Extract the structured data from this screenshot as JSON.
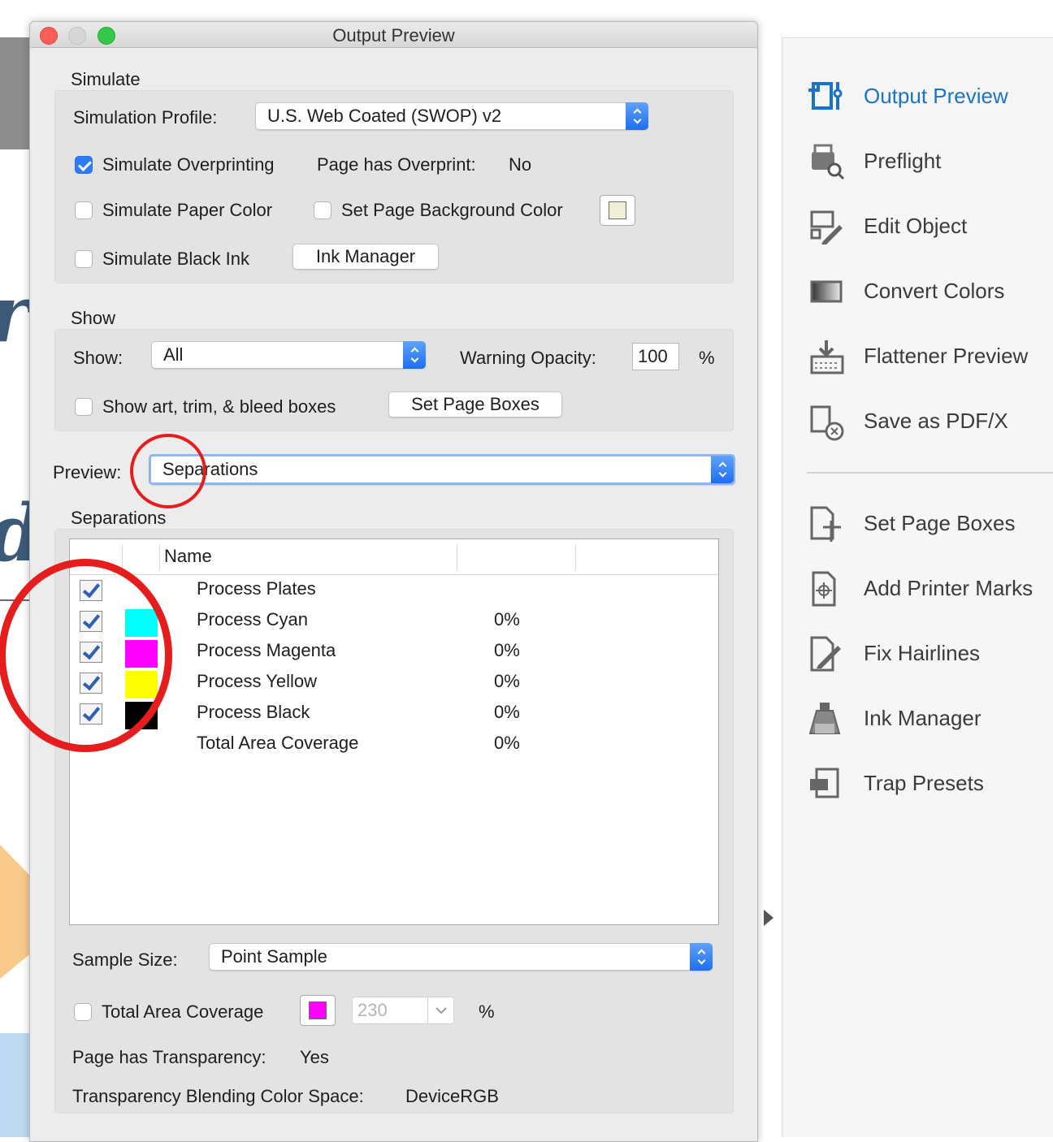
{
  "dialog": {
    "title": "Output Preview"
  },
  "simulate": {
    "section": "Simulate",
    "profile_label": "Simulation Profile:",
    "profile_value": "U.S. Web Coated (SWOP) v2",
    "overprint_label": "Simulate Overprinting",
    "overprint_checked": true,
    "page_overprint_label": "Page has Overprint:",
    "page_overprint_value": "No",
    "paper_color_label": "Simulate Paper Color",
    "bg_color_label": "Set Page Background Color",
    "black_ink_label": "Simulate Black Ink",
    "ink_manager_button": "Ink Manager",
    "bg_swatch_color": "#efefd8"
  },
  "show": {
    "section": "Show",
    "show_label": "Show:",
    "show_value": "All",
    "warning_label": "Warning Opacity:",
    "warning_value": "100",
    "percent": "%",
    "boxes_label": "Show art, trim, & bleed boxes",
    "set_page_boxes_button": "Set Page Boxes"
  },
  "preview": {
    "label": "Preview:",
    "value": "Separations"
  },
  "separations": {
    "section": "Separations",
    "name_header": "Name",
    "rows": [
      {
        "name": "Process Plates",
        "pct": "",
        "color": ""
      },
      {
        "name": "Process Cyan",
        "pct": "0%",
        "color": "#00ffff"
      },
      {
        "name": "Process Magenta",
        "pct": "0%",
        "color": "#ff00ff"
      },
      {
        "name": "Process Yellow",
        "pct": "0%",
        "color": "#ffff00"
      },
      {
        "name": "Process Black",
        "pct": "0%",
        "color": "#000000"
      },
      {
        "name": "Total Area Coverage",
        "pct": "0%",
        "color": ""
      }
    ]
  },
  "sample": {
    "label": "Sample Size:",
    "value": "Point Sample",
    "tac_label": "Total Area Coverage",
    "tac_value": "230",
    "tac_swatch": "#ff00ff",
    "percent": "%",
    "transparency_label": "Page has Transparency:",
    "transparency_value": "Yes",
    "blend_label": "Transparency Blending Color Space:",
    "blend_value": "DeviceRGB"
  },
  "tools": [
    {
      "label": "Output Preview",
      "icon": "output-preview-icon",
      "active": true
    },
    {
      "label": "Preflight",
      "icon": "preflight-icon"
    },
    {
      "label": "Edit Object",
      "icon": "edit-object-icon"
    },
    {
      "label": "Convert Colors",
      "icon": "convert-colors-icon"
    },
    {
      "label": "Flattener Preview",
      "icon": "flattener-preview-icon"
    },
    {
      "label": "Save as PDF/X",
      "icon": "save-pdfx-icon"
    },
    {
      "label": "Set Page Boxes",
      "icon": "set-page-boxes-icon"
    },
    {
      "label": "Add Printer Marks",
      "icon": "add-printer-marks-icon"
    },
    {
      "label": "Fix Hairlines",
      "icon": "fix-hairlines-icon"
    },
    {
      "label": "Ink Manager",
      "icon": "ink-manager-icon"
    },
    {
      "label": "Trap Presets",
      "icon": "trap-presets-icon"
    }
  ],
  "colors": {
    "accent": "#1a73c9",
    "annotation": "#e51d1d"
  }
}
